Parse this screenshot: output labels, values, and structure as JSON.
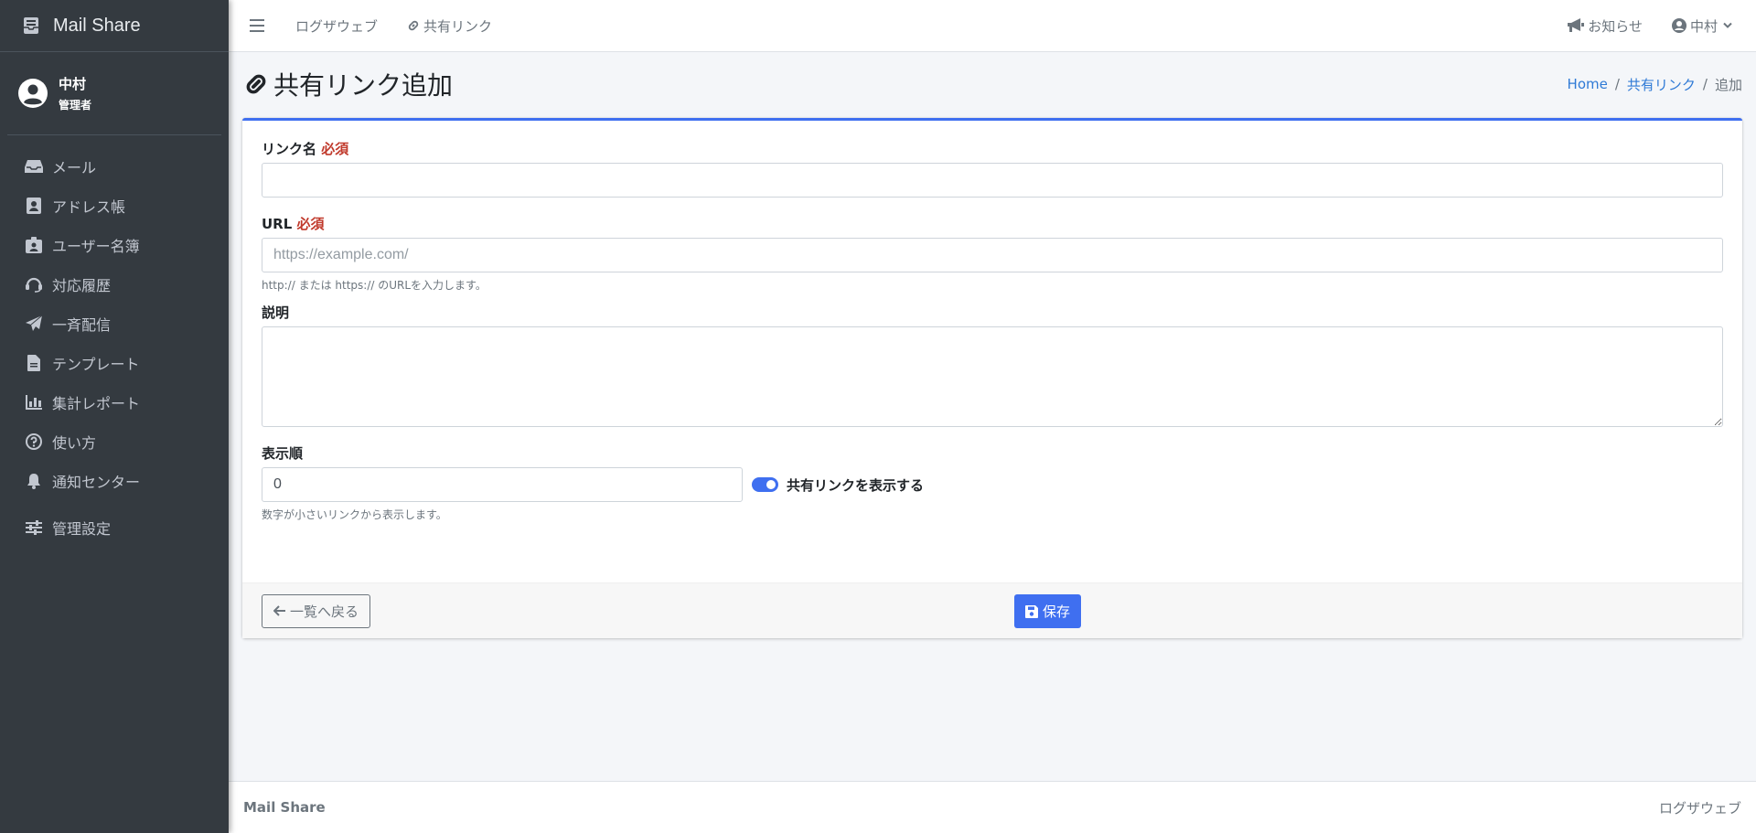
{
  "sidebar": {
    "brand": "Mail Share",
    "user": {
      "name": "中村",
      "role": "管理者"
    },
    "items": [
      {
        "label": "メール",
        "icon": "inbox-icon"
      },
      {
        "label": "アドレス帳",
        "icon": "address-book-icon"
      },
      {
        "label": "ユーザー名簿",
        "icon": "id-badge-icon"
      },
      {
        "label": "対応履歴",
        "icon": "headset-icon"
      },
      {
        "label": "一斉配信",
        "icon": "paper-plane-icon"
      },
      {
        "label": "テンプレート",
        "icon": "file-icon"
      },
      {
        "label": "集計レポート",
        "icon": "bar-chart-icon"
      },
      {
        "label": "使い方",
        "icon": "question-circle-icon"
      },
      {
        "label": "通知センター",
        "icon": "bell-icon"
      },
      {
        "label": "管理設定",
        "icon": "sliders-icon"
      }
    ]
  },
  "topbar": {
    "link_logweb": "ログザウェブ",
    "link_shared": "共有リンク",
    "notice": "お知らせ",
    "user": "中村"
  },
  "header": {
    "title": "共有リンク追加",
    "breadcrumb": {
      "home": "Home",
      "shared": "共有リンク",
      "current": "追加",
      "sep": "/"
    }
  },
  "form": {
    "link_name": {
      "label": "リンク名",
      "required": "必須",
      "value": ""
    },
    "url": {
      "label": "URL",
      "required": "必須",
      "value": "",
      "placeholder": "https://example.com/",
      "help": "http:// または https:// のURLを入力します。"
    },
    "description": {
      "label": "説明",
      "value": ""
    },
    "order": {
      "label": "表示順",
      "value": "0",
      "help": "数字が小さいリンクから表示します。"
    },
    "visible": {
      "label": "共有リンクを表示する",
      "checked": true
    }
  },
  "actions": {
    "back": "一覧へ戻る",
    "save": "保存"
  },
  "footer": {
    "brand": "Mail Share",
    "right": "ログザウェブ"
  },
  "colors": {
    "sidebar_bg": "#343a40",
    "primary": "#3f6ff0",
    "required": "#c0392b",
    "link": "#2f7ad6"
  }
}
